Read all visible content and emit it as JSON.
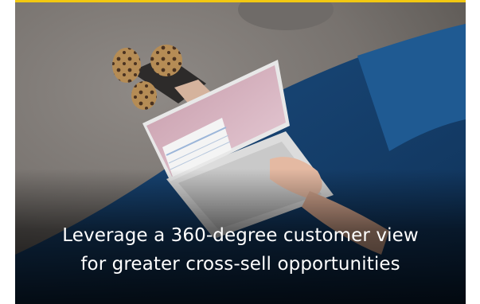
{
  "card": {
    "accent_color": "#f2c811",
    "headline_line1": "Leverage a 360-degree customer view",
    "headline_line2": "for greater cross-sell opportunities"
  }
}
